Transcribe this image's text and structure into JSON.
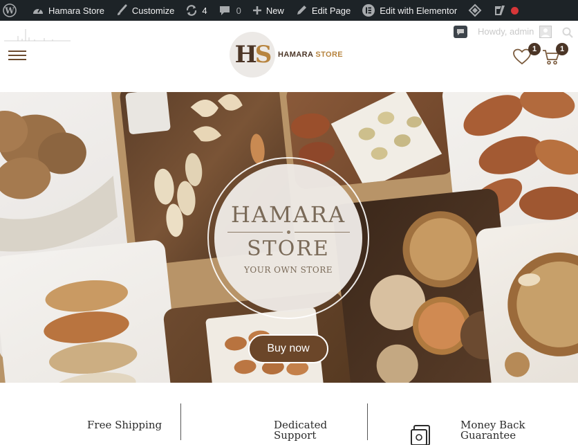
{
  "admin_bar": {
    "site_name": "Hamara Store",
    "customize": "Customize",
    "updates_count": "4",
    "comments_count": "0",
    "new": "New",
    "edit_page": "Edit Page",
    "edit_elementor": "Edit with Elementor"
  },
  "header": {
    "howdy": "Howdy, admin",
    "logo_mark": {
      "h": "H",
      "s": "S"
    },
    "logo_text_main": "HAMARA",
    "logo_text_accent": "STORE",
    "wishlist_count": "1",
    "cart_count": "1"
  },
  "hero": {
    "emblem_line1": "HAMARA",
    "emblem_line2": "STORE",
    "emblem_tagline": "YOUR OWN STORE",
    "cta_label": "Buy now"
  },
  "features": [
    {
      "title": "Free Shipping"
    },
    {
      "title": "Dedicated Support"
    },
    {
      "title": "Money Back Guarantee"
    }
  ],
  "colors": {
    "admin_bar": "#1d2327",
    "brand_brown": "#4b3526",
    "brand_gold": "#b7843f",
    "hero_bg": "#b89468",
    "cta": "#6b4629"
  }
}
